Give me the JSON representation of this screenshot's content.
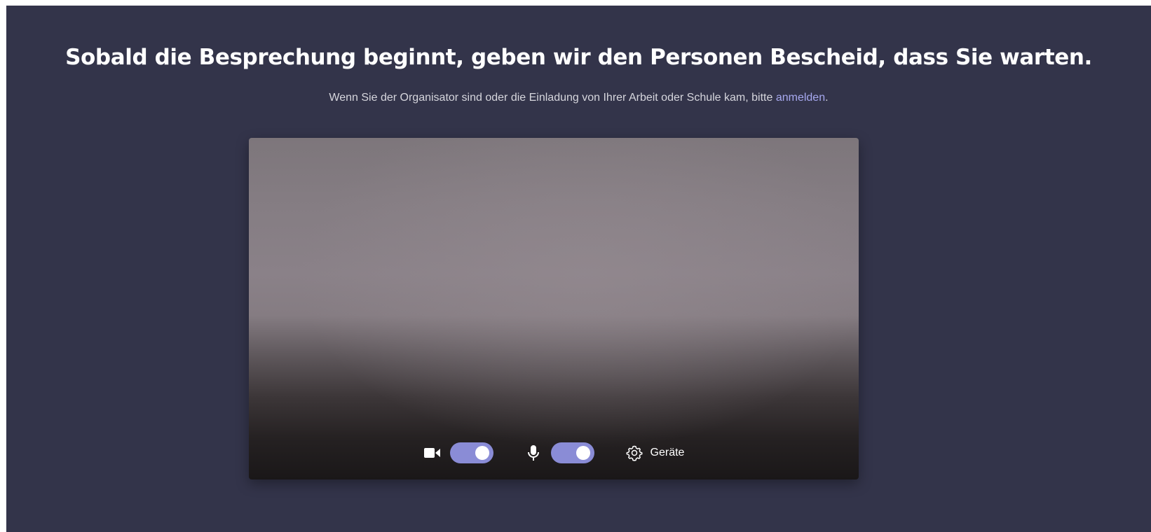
{
  "lobby": {
    "heading": "Sobald die Besprechung beginnt, geben wir den Personen Bescheid, dass Sie warten.",
    "subline_prefix": "Wenn Sie der Organisator sind oder die Einladung von Ihrer Arbeit oder Schule kam, bitte ",
    "signin_link": "anmelden",
    "subline_suffix": "."
  },
  "preview": {
    "controls": {
      "camera": {
        "icon": "video-camera-icon",
        "on": true
      },
      "microphone": {
        "icon": "microphone-icon",
        "on": true
      },
      "devices": {
        "icon": "gear-icon",
        "label": "Geräte"
      }
    }
  },
  "colors": {
    "background": "#33344a",
    "toggle_on": "#8a8cd6",
    "link": "#a7a9f0",
    "text": "#ffffff"
  }
}
